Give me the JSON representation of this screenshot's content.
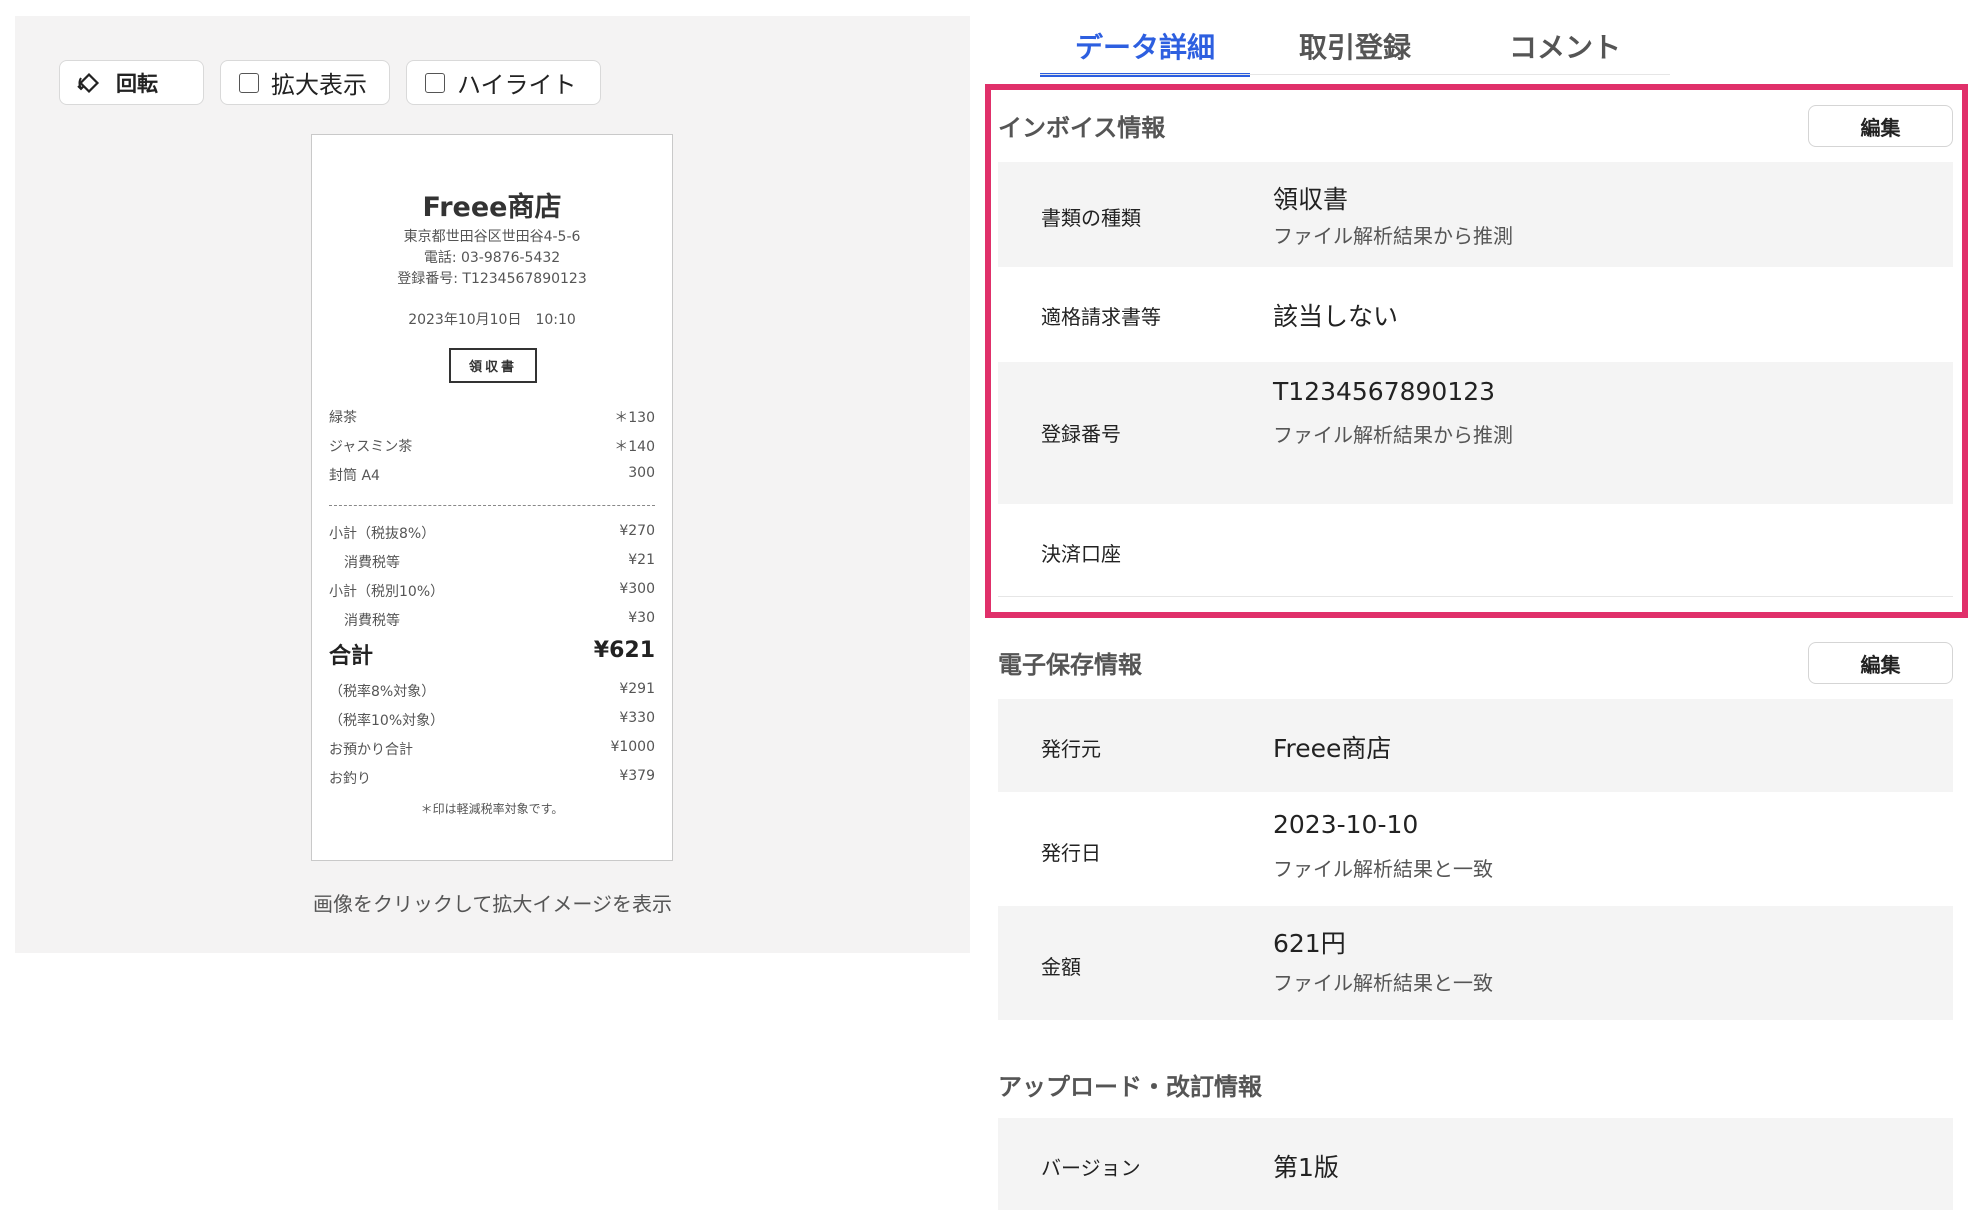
{
  "toolbar": {
    "rotate_label": "回転",
    "zoom_label": "拡大表示",
    "highlight_label": "ハイライト"
  },
  "receipt": {
    "shop": "Freee商店",
    "address": "東京都世田谷区世田谷4-5-6",
    "phone": "電話: 03-9876-5432",
    "registration": "登録番号: T1234567890123",
    "datetime": "2023年10月10日　10:10",
    "doc_label": "領収書",
    "items": [
      {
        "name": "緑茶",
        "price": "＊130"
      },
      {
        "name": "ジャスミン茶",
        "price": "＊140"
      },
      {
        "name": "封筒 A4",
        "price": "300"
      }
    ],
    "summary": [
      {
        "name": "小計（税抜8%）",
        "price": "¥270"
      },
      {
        "name": "消費税等",
        "price": "¥21"
      },
      {
        "name": "小計（税別10%）",
        "price": "¥300"
      },
      {
        "name": "消費税等",
        "price": "¥30"
      }
    ],
    "total_label": "合計",
    "total_value": "¥621",
    "breakdown": [
      {
        "name": "（税率8%対象）",
        "price": "¥291"
      },
      {
        "name": "（税率10%対象）",
        "price": "¥330"
      },
      {
        "name": "お預かり合計",
        "price": "¥1000"
      },
      {
        "name": "お釣り",
        "price": "¥379"
      }
    ],
    "note": "＊印は軽減税率対象です。"
  },
  "preview_caption": "画像をクリックして拡大イメージを表示",
  "tabs": [
    {
      "label": "データ詳細",
      "active": true
    },
    {
      "label": "取引登録",
      "active": false
    },
    {
      "label": "コメント",
      "active": false
    }
  ],
  "invoice_section": {
    "title": "インボイス情報",
    "edit_label": "編集",
    "rows": [
      {
        "label": "書類の種類",
        "value": "領収書",
        "sub": "ファイル解析結果から推測"
      },
      {
        "label": "適格請求書等",
        "value": "該当しない",
        "sub": ""
      },
      {
        "label": "登録番号",
        "value": "T1234567890123",
        "sub": "ファイル解析結果から推測"
      },
      {
        "label": "決済口座",
        "value": "",
        "sub": ""
      }
    ]
  },
  "storage_section": {
    "title": "電子保存情報",
    "edit_label": "編集",
    "rows": [
      {
        "label": "発行元",
        "value": "Freee商店",
        "sub": ""
      },
      {
        "label": "発行日",
        "value": "2023-10-10",
        "sub": "ファイル解析結果と一致"
      },
      {
        "label": "金額",
        "value": "621円",
        "sub": "ファイル解析結果と一致"
      }
    ]
  },
  "upload_section": {
    "title": "アップロード・改訂情報",
    "rows": [
      {
        "label": "バージョン",
        "value": "第1版",
        "sub": ""
      }
    ]
  },
  "colors": {
    "accent": "#2d5fe0",
    "highlight_border": "#e0306a",
    "row_shade": "#f4f4f4"
  }
}
